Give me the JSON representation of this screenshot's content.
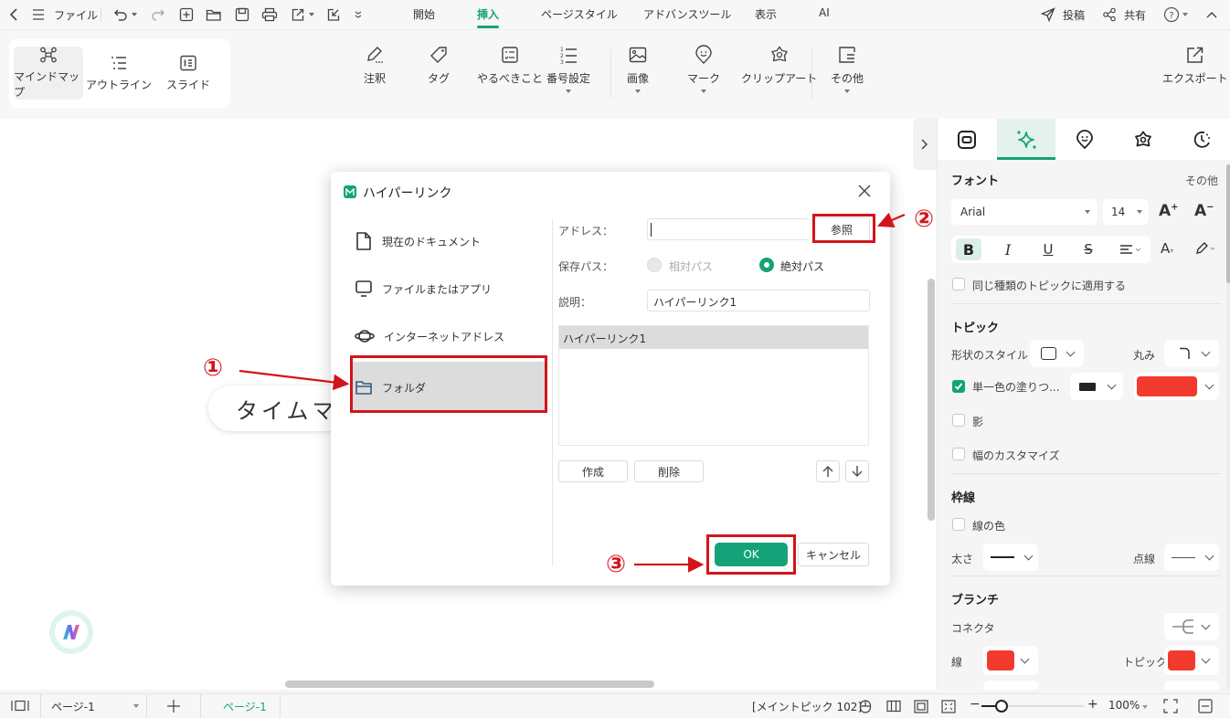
{
  "topbar": {
    "file_label": "ファイル",
    "menu_tabs": [
      "開始",
      "挿入",
      "ページスタイル",
      "アドバンスツール",
      "表示",
      "AI"
    ],
    "active_tab": "挿入",
    "post_label": "投稿",
    "share_label": "共有"
  },
  "ribbon": {
    "views": [
      "マインドマップ",
      "アウトライン",
      "スライド"
    ],
    "active_view": "マインドマップ",
    "tools": [
      "注釈",
      "タグ",
      "やるべきこと",
      "番号設定",
      "画像",
      "マーク",
      "クリップアート",
      "その他"
    ],
    "export_label": "エクスポート"
  },
  "canvas": {
    "topic_text": "タイムマ"
  },
  "dialog": {
    "title": "ハイパーリンク",
    "sidebar": [
      "現在のドキュメント",
      "ファイルまたはアプリ",
      "インターネットアドレス",
      "フォルダ"
    ],
    "active_item": "フォルダ",
    "address_label": "アドレス：",
    "address_value": "",
    "browse_label": "参照",
    "save_path_label": "保存パス：",
    "relative_label": "相対パス",
    "absolute_label": "絶対パス",
    "save_path_selected": "絶対パス",
    "description_label": "説明：",
    "description_value": "ハイパーリンク1",
    "list_items": [
      "ハイパーリンク1"
    ],
    "create_label": "作成",
    "delete_label": "削除",
    "ok_label": "OK",
    "cancel_label": "キャンセル"
  },
  "annotations": {
    "one": "①",
    "two": "②",
    "three": "③",
    "color": "#d3141b"
  },
  "panel": {
    "font_title": "フォント",
    "more_label": "その他",
    "font_family": "Arial",
    "font_size": "14",
    "apply_same_label": "同じ種類のトピックに適用する",
    "topic_title": "トピック",
    "shape_style_label": "形状のスタイル",
    "corner_label": "丸み",
    "fill_label": "単一色の塗りつ...",
    "fill_checked": true,
    "fill_color": "#f33a2f",
    "shadow_label": "影",
    "custom_width_label": "幅のカスタマイズ",
    "border_title": "枠線",
    "line_color_label": "線の色",
    "thickness_label": "太さ",
    "dash_label": "点線",
    "branch_title": "ブランチ",
    "connector_label": "コネクタ",
    "line_label": "線",
    "topic_label": "トピック",
    "branch_line_color": "#f33a2f",
    "branch_topic_color": "#f33a2f"
  },
  "statusbar": {
    "page_select": "ページ-1",
    "page_tab": "ページ-1",
    "main_topic_count": "[メイントピック 102]",
    "zoom_percent": "100%",
    "zoom_fraction": 0.2
  },
  "colors": {
    "accent": "#14a378"
  }
}
